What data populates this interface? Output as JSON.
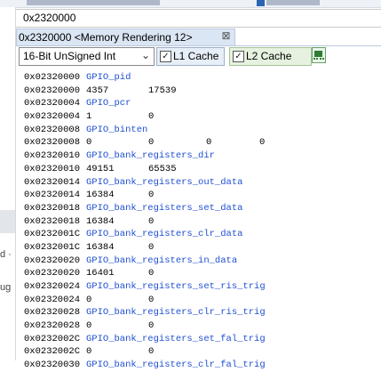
{
  "address_bar": {
    "value": "0x2320000"
  },
  "view_tab": {
    "title": "0x2320000 <Memory Rendering 12>",
    "close_glyph": "⊠"
  },
  "toolbar": {
    "format_select": {
      "value": "16-Bit UnSigned Int",
      "chevron": "⌄"
    },
    "l1_cache": {
      "label": "L1 Cache",
      "checked": true
    },
    "l2_cache": {
      "label": "L2 Cache",
      "checked": true
    },
    "check_glyph": "✓"
  },
  "left_fragments": [
    "d ·",
    "ug"
  ],
  "memory_rows": [
    {
      "address": "0x02320000",
      "name": "GPIO_pid"
    },
    {
      "address": "0x02320000",
      "values": [
        "4357",
        "17539"
      ]
    },
    {
      "address": "0x02320004",
      "name": "GPIO_pcr"
    },
    {
      "address": "0x02320004",
      "values": [
        "1",
        "0"
      ]
    },
    {
      "address": "0x02320008",
      "name": "GPIO_binten"
    },
    {
      "address": "0x02320008",
      "values": [
        "0",
        "0",
        "0",
        "0"
      ]
    },
    {
      "address": "0x02320010",
      "name": "GPIO_bank_registers_dir"
    },
    {
      "address": "0x02320010",
      "values": [
        "49151",
        "65535"
      ]
    },
    {
      "address": "0x02320014",
      "name": "GPIO_bank_registers_out_data"
    },
    {
      "address": "0x02320014",
      "values": [
        "16384",
        "0"
      ]
    },
    {
      "address": "0x02320018",
      "name": "GPIO_bank_registers_set_data"
    },
    {
      "address": "0x02320018",
      "values": [
        "16384",
        "0"
      ]
    },
    {
      "address": "0x0232001C",
      "name": "GPIO_bank_registers_clr_data"
    },
    {
      "address": "0x0232001C",
      "values": [
        "16384",
        "0"
      ]
    },
    {
      "address": "0x02320020",
      "name": "GPIO_bank_registers_in_data"
    },
    {
      "address": "0x02320020",
      "values": [
        "16401",
        "0"
      ]
    },
    {
      "address": "0x02320024",
      "name": "GPIO_bank_registers_set_ris_trig"
    },
    {
      "address": "0x02320024",
      "values": [
        "0",
        "0"
      ]
    },
    {
      "address": "0x02320028",
      "name": "GPIO_bank_registers_clr_ris_trig"
    },
    {
      "address": "0x02320028",
      "values": [
        "0",
        "0"
      ]
    },
    {
      "address": "0x0232002C",
      "name": "GPIO_bank_registers_set_fal_trig"
    },
    {
      "address": "0x0232002C",
      "values": [
        "0",
        "0"
      ]
    },
    {
      "address": "0x02320030",
      "name": "GPIO_bank_registers_clr_fal_trig"
    }
  ],
  "colors": {
    "register_name": "#1f4fd1",
    "tab_background": "#dbe6f4",
    "l2_background": "#e6f2df"
  }
}
